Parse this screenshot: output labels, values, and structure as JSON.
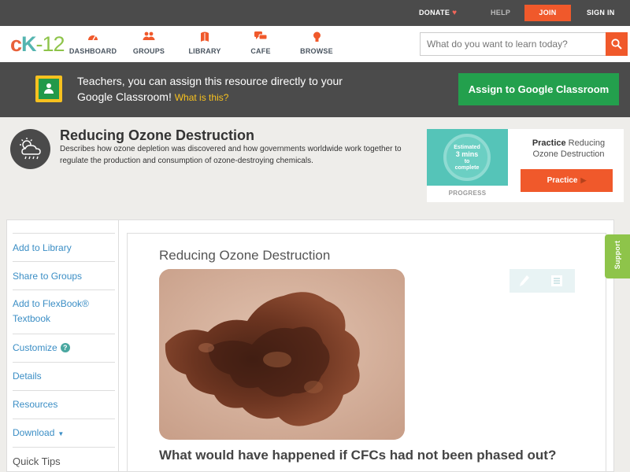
{
  "topbar": {
    "donate": "DONATE",
    "help": "HELP",
    "join": "JOIN",
    "signin": "SIGN IN"
  },
  "logo": {
    "c": "c",
    "k": "K",
    "rest": "-12"
  },
  "nav": [
    {
      "label": "DASHBOARD",
      "icon": "dashboard-gauge-icon"
    },
    {
      "label": "GROUPS",
      "icon": "groups-people-icon"
    },
    {
      "label": "LIBRARY",
      "icon": "library-book-icon"
    },
    {
      "label": "CAFE",
      "icon": "cafe-chat-icon"
    },
    {
      "label": "BROWSE",
      "icon": "browse-lightbulb-icon"
    }
  ],
  "search": {
    "placeholder": "What do you want to learn today?"
  },
  "banner": {
    "text": "Teachers, you can assign this resource directly to your Google Classroom!",
    "what_link": "What is this?",
    "assign_label": "Assign to Google Classroom"
  },
  "concept": {
    "title": "Reducing Ozone Destruction",
    "description": "Describes how ozone depletion was discovered and how governments worldwide work together to regulate the production and consumption of ozone-destroying chemicals.",
    "icon": "cloud-sun-rain-icon"
  },
  "practice": {
    "estimated_line1": "Estimated",
    "estimated_line2": "3 mins",
    "estimated_line3": "to complete",
    "progress_label": "PROGRESS",
    "practice_bold": "Practice",
    "practice_rest": " Reducing Ozone Destruction",
    "button_label": "Practice"
  },
  "sidebar": {
    "items": [
      {
        "label": "Add to Library"
      },
      {
        "label": "Share to Groups"
      },
      {
        "label": "Add to FlexBook® Textbook"
      },
      {
        "label": "Customize"
      },
      {
        "label": "Details"
      },
      {
        "label": "Resources"
      },
      {
        "label": "Download"
      },
      {
        "label": "Quick Tips"
      }
    ],
    "help_badge": "?"
  },
  "content": {
    "title": "Reducing Ozone Destruction",
    "question": "What would have happened if CFCs had not been phased out?"
  },
  "support": "Support",
  "colors": {
    "accent": "#f0592b",
    "banner_bg": "#4b4b4b",
    "classroom_green": "#23a04d",
    "link_blue": "#3b8ec5",
    "teal": "#55c4b8",
    "support_green": "#8ec44a"
  }
}
